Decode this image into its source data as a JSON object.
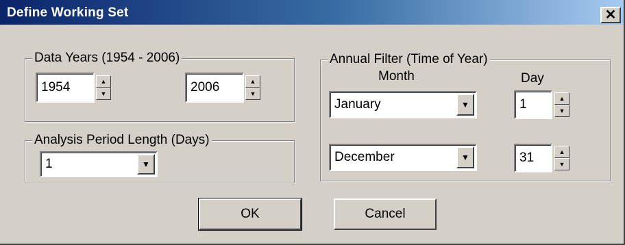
{
  "window": {
    "title": "Define Working Set",
    "close_glyph": "✕"
  },
  "data_years": {
    "label": "Data Years (1954 - 2006)",
    "start_value": "1954",
    "end_value": "2006"
  },
  "analysis_period": {
    "label": "Analysis Period Length (Days)",
    "selected": "1"
  },
  "annual_filter": {
    "label": "Annual Filter (Time of Year)",
    "month_header": "Month",
    "day_header": "Day",
    "start_month": "January",
    "start_day": "1",
    "end_month": "December",
    "end_day": "31"
  },
  "buttons": {
    "ok": "OK",
    "cancel": "Cancel"
  },
  "icons": {
    "spin_up": "▲",
    "spin_down": "▼",
    "dropdown": "▼"
  }
}
